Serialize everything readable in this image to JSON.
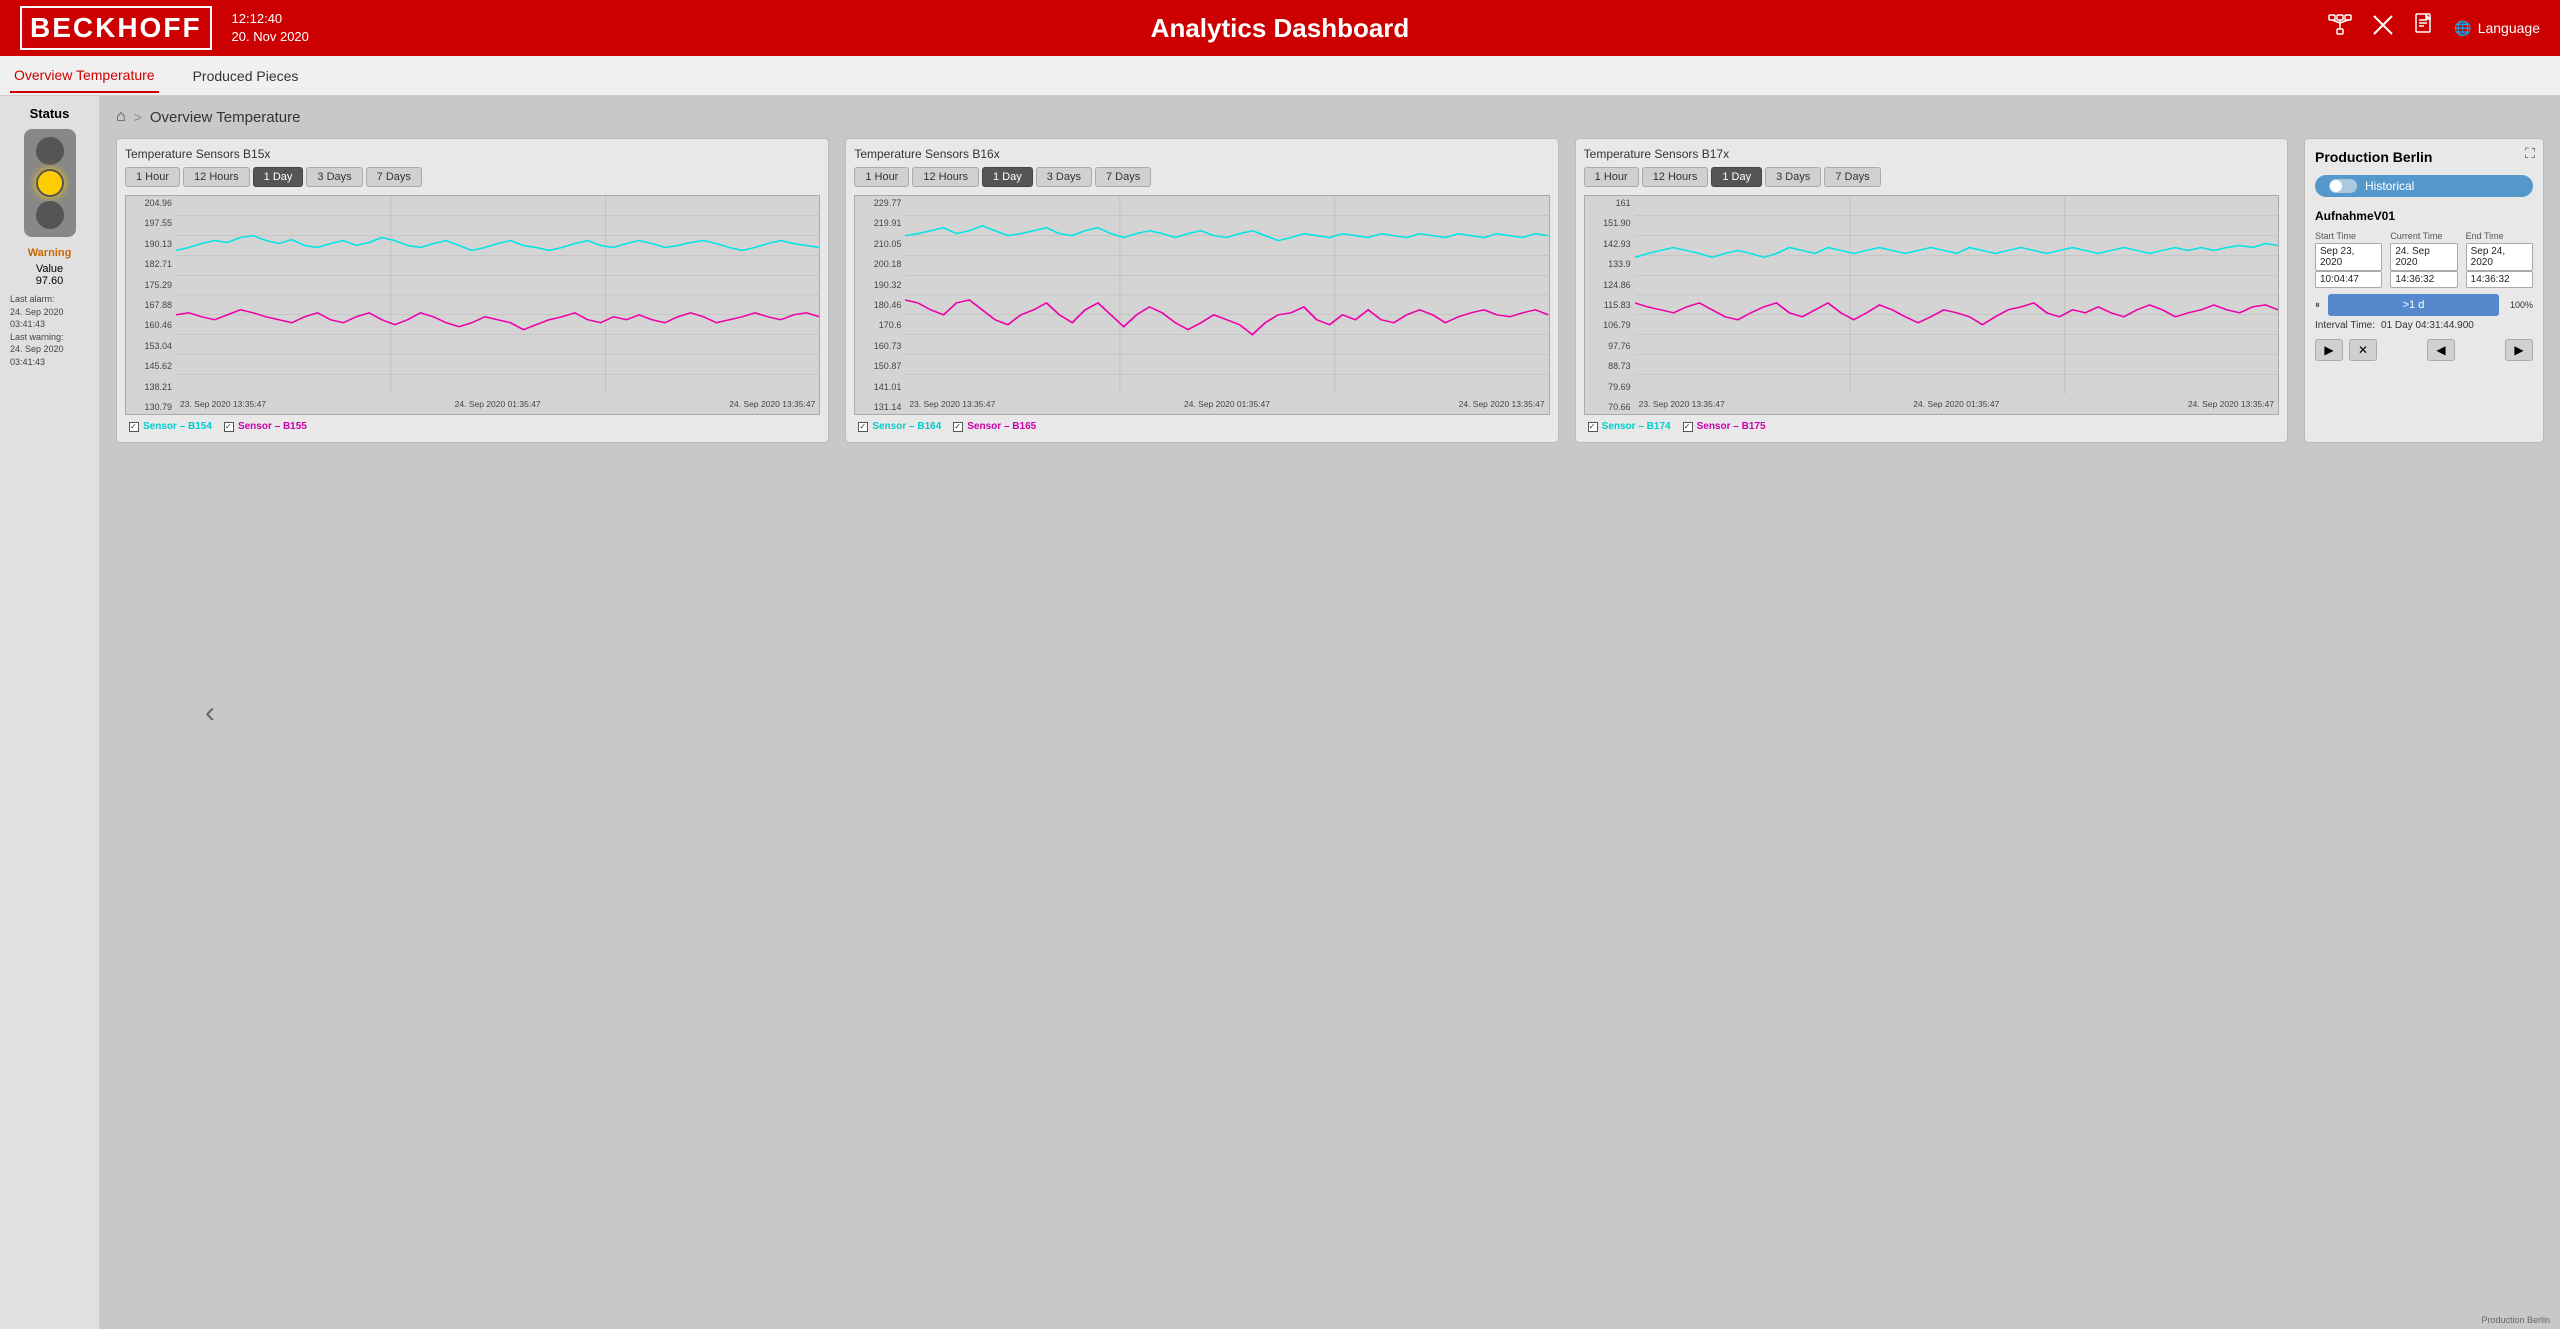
{
  "header": {
    "logo": "BECKHOFF",
    "datetime": "12:12:40\n20. Nov 2020",
    "time": "12:12:40",
    "date": "20. Nov 2020",
    "title": "Analytics Dashboard",
    "language_label": "Language",
    "icon_network": "⊞",
    "icon_tools": "✕",
    "icon_doc": "📄"
  },
  "nav": {
    "items": [
      {
        "label": "Overview Temperature",
        "active": true
      },
      {
        "label": "Produced Pieces",
        "active": false
      }
    ]
  },
  "sidebar": {
    "status_label": "Status",
    "warning_label": "Warning",
    "value_label": "Value",
    "value": "97.60",
    "last_alarm_label": "Last alarm:",
    "last_alarm": "24. Sep 2020 03:41:43",
    "last_warning_label": "Last warning:",
    "last_warning": "24. Sep 2020 03:41:43"
  },
  "breadcrumb": {
    "home_icon": "⌂",
    "separator": ">",
    "text": "Overview Temperature"
  },
  "charts": [
    {
      "id": "b15x",
      "title": "Temperature Sensors B15x",
      "time_buttons": [
        "1 Hour",
        "12 Hours",
        "1 Day",
        "3 Days",
        "7 Days"
      ],
      "active_button": "1 Day",
      "y_labels": [
        "204.96",
        "197.55",
        "190.13",
        "182.71",
        "175.29",
        "167.88",
        "160.46",
        "153.04",
        "145.62",
        "138.21",
        "130.79"
      ],
      "x_labels": [
        "23. Sep 2020 13:35:47",
        "24. Sep 2020 01:35:47",
        "24. Sep 2020 13:35:47"
      ],
      "legend": [
        {
          "color": "cyan",
          "label": "Sensor - B154"
        },
        {
          "color": "magenta",
          "label": "Sensor - B155"
        }
      ]
    },
    {
      "id": "b16x",
      "title": "Temperature Sensors B16x",
      "time_buttons": [
        "1 Hour",
        "12 Hours",
        "1 Day",
        "3 Days",
        "7 Days"
      ],
      "active_button": "1 Day",
      "y_labels": [
        "229.77",
        "219.91",
        "210.05",
        "200.18",
        "190.32",
        "180.46",
        "170.6",
        "160.73",
        "150.87",
        "141.01",
        "131.14"
      ],
      "x_labels": [
        "23. Sep 2020 13:35:47",
        "24. Sep 2020 01:35:47",
        "24. Sep 2020 13:35:47"
      ],
      "legend": [
        {
          "color": "cyan",
          "label": "Sensor - B164"
        },
        {
          "color": "magenta",
          "label": "Sensor - B165"
        }
      ]
    },
    {
      "id": "b17x",
      "title": "Temperature Sensors B17x",
      "time_buttons": [
        "1 Hour",
        "12 Hours",
        "1 Day",
        "3 Days",
        "7 Days"
      ],
      "active_button": "1 Day",
      "y_labels": [
        "161",
        "151.90",
        "142.93",
        "133.9",
        "124.86",
        "115.83",
        "106.79",
        "97.76",
        "88.73",
        "79.69",
        "70.66"
      ],
      "x_labels": [
        "23. Sep 2020 13:35:47",
        "24. Sep 2020 01:35:47",
        "24. Sep 2020 13:35:47"
      ],
      "legend": [
        {
          "color": "cyan",
          "label": "Sensor - B174"
        },
        {
          "color": "magenta",
          "label": "Sensor - B175"
        }
      ]
    }
  ],
  "right_panel": {
    "title": "Production Berlin",
    "historical_label": "Historical",
    "aufnahme_label": "AufnahmeV01",
    "start_time_label": "Start Time",
    "current_time_label": "Current Time",
    "end_time_label": "End Time",
    "start_time_date": "Sep 23, 2020",
    "start_time_val": "10:04:47",
    "current_time_date": "24. Sep 2020",
    "current_time_val": "14:36:32",
    "end_time_date": "Sep 24, 2020",
    "end_time_val": "14:36:32",
    "progress_percent": "100%",
    "progress_bar_label": ">1 d",
    "interval_label": "Interval Time:",
    "interval_value": "01 Day 04:31:44.900",
    "play_btn": "▶",
    "stop_btn": "✕",
    "back_btn": "◀",
    "fwd_btn": "▶"
  },
  "footer": {
    "text": "Production Berlin"
  }
}
